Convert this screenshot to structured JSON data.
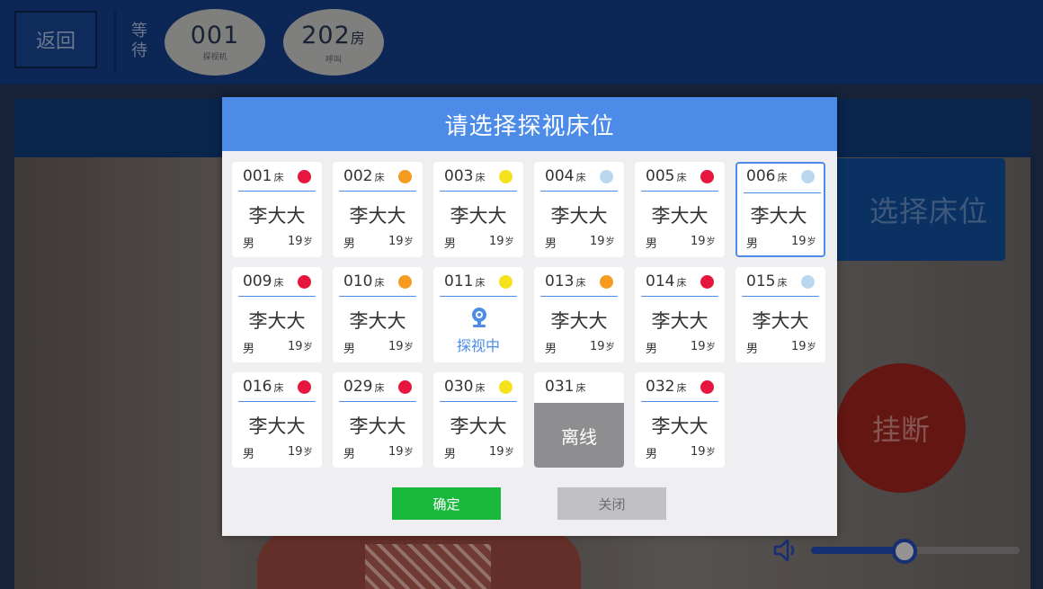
{
  "topbar": {
    "back_label": "返回",
    "wait_label": "等待",
    "device": {
      "number": "001",
      "sub": "探视机"
    },
    "room": {
      "number": "202",
      "suffix": "房",
      "sub": "呼叫"
    }
  },
  "video": {
    "select_bed_label": "选择床位",
    "hangup_label": "挂断",
    "volume_level": 0.44
  },
  "modal": {
    "title": "请选择探视床位",
    "bed_unit": "床",
    "age_unit": "岁",
    "confirm_label": "确定",
    "close_label": "关闭",
    "beds": [
      {
        "number": "001",
        "name": "李大大",
        "sex": "男",
        "age": "19",
        "dot": "#e5173f",
        "status": "normal"
      },
      {
        "number": "002",
        "name": "李大大",
        "sex": "男",
        "age": "19",
        "dot": "#f59b1f",
        "status": "normal"
      },
      {
        "number": "003",
        "name": "李大大",
        "sex": "男",
        "age": "19",
        "dot": "#f4e21e",
        "status": "normal"
      },
      {
        "number": "004",
        "name": "李大大",
        "sex": "男",
        "age": "19",
        "dot": "#b9d8ef",
        "status": "normal"
      },
      {
        "number": "005",
        "name": "李大大",
        "sex": "男",
        "age": "19",
        "dot": "#e5173f",
        "status": "normal"
      },
      {
        "number": "006",
        "name": "李大大",
        "sex": "男",
        "age": "19",
        "dot": "#b9d8ef",
        "status": "selected"
      },
      {
        "number": "009",
        "name": "李大大",
        "sex": "男",
        "age": "19",
        "dot": "#e5173f",
        "status": "normal"
      },
      {
        "number": "010",
        "name": "李大大",
        "sex": "男",
        "age": "19",
        "dot": "#f59b1f",
        "status": "normal"
      },
      {
        "number": "011",
        "visit_label": "探视中",
        "dot": "#f4e21e",
        "status": "visiting"
      },
      {
        "number": "013",
        "name": "李大大",
        "sex": "男",
        "age": "19",
        "dot": "#f59b1f",
        "status": "normal"
      },
      {
        "number": "014",
        "name": "李大大",
        "sex": "男",
        "age": "19",
        "dot": "#e5173f",
        "status": "normal"
      },
      {
        "number": "015",
        "name": "李大大",
        "sex": "男",
        "age": "19",
        "dot": "#b9d8ef",
        "status": "normal"
      },
      {
        "number": "016",
        "name": "李大大",
        "sex": "男",
        "age": "19",
        "dot": "#e5173f",
        "status": "normal"
      },
      {
        "number": "029",
        "name": "李大大",
        "sex": "男",
        "age": "19",
        "dot": "#e5173f",
        "status": "normal"
      },
      {
        "number": "030",
        "name": "李大大",
        "sex": "男",
        "age": "19",
        "dot": "#f4e21e",
        "status": "normal"
      },
      {
        "number": "031",
        "offline_label": "离线",
        "status": "offline"
      },
      {
        "number": "032",
        "name": "李大大",
        "sex": "男",
        "age": "19",
        "dot": "#e5173f",
        "status": "normal"
      }
    ]
  },
  "colors": {
    "accent": "#4c8ce8",
    "confirm": "#1ab83c",
    "offline": "#8e8e90"
  }
}
